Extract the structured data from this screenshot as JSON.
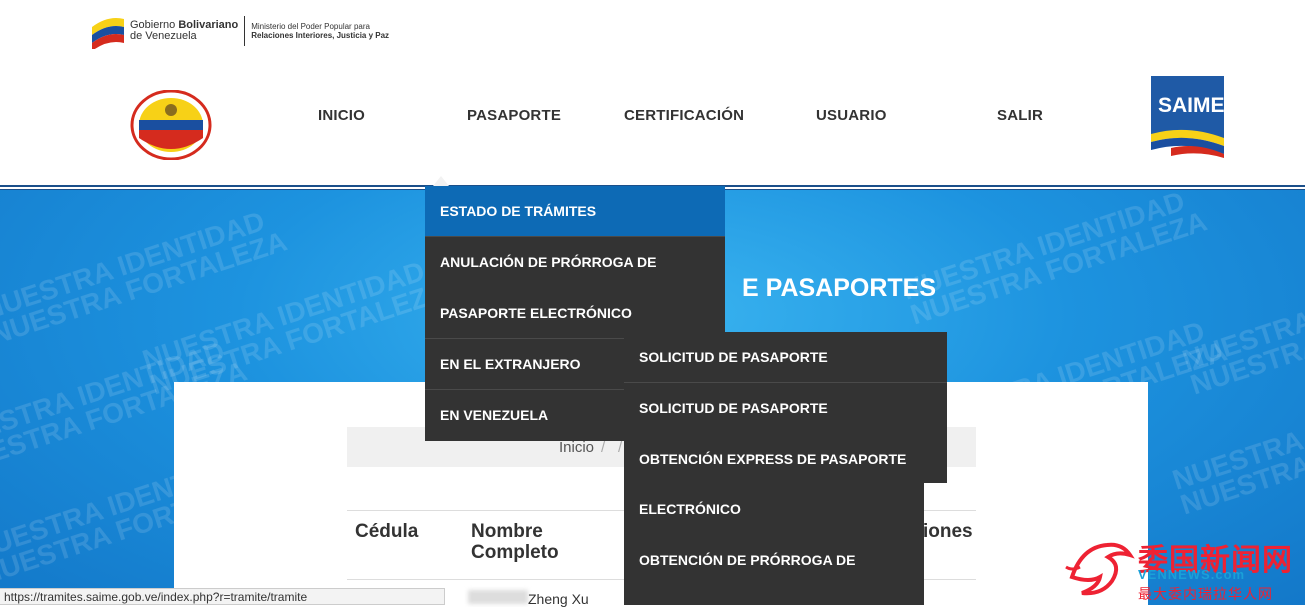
{
  "gov": {
    "line1_a": "Gobierno ",
    "line1_b": "Bolivariano",
    "line2": "de Venezuela",
    "ministry_1": "Ministerio del Poder Popular para",
    "ministry_2": "Relaciones Interiores, Justicia y Paz"
  },
  "nav": {
    "inicio": "INICIO",
    "pasaporte": "PASAPORTE",
    "certificacion": "CERTIFICACIÓN",
    "usuario": "USUARIO",
    "salir": "SALIR",
    "saime_logo": "SAIME"
  },
  "banner": {
    "title_right": "E PASAPORTES",
    "watermark_1": "NUESTRA IDENTIDAD",
    "watermark_2": "NUESTRA FORTALEZA"
  },
  "dropdown_pasaporte": {
    "items": [
      "ESTADO DE TRÁMITES",
      "ANULACIÓN DE PRÓRROGA DE",
      "PASAPORTE ELECTRÓNICO",
      "EN EL EXTRANJERO",
      "EN VENEZUELA"
    ]
  },
  "submenu": {
    "items": [
      "SOLICITUD DE PASAPORTE",
      "SOLICITUD DE PASAPORTE",
      "OBTENCIÓN EXPRESS DE PASAPORTE",
      "ELECTRÓNICO",
      "OBTENCIÓN DE PRÓRROGA DE"
    ]
  },
  "breadcrumb": {
    "home": "Inicio",
    "sep": "/",
    "sep2": "/"
  },
  "table": {
    "headers": [
      "Cédula",
      "Nombre",
      "Completo",
      "iones"
    ],
    "row1_name": "Zheng Xu"
  },
  "status_url": "https://tramites.saime.gob.ve/index.php?r=tramite/tramite",
  "watermark_news": {
    "big": "委国新闻网",
    "url": "VENNEWS.com",
    "sub": "最大委内瑞拉华人网"
  },
  "colors": {
    "dropdown_bg": "#333333",
    "active_item": "#0d6ab5",
    "banner": "#1d93df",
    "nav_line": "#1b4f8a"
  }
}
